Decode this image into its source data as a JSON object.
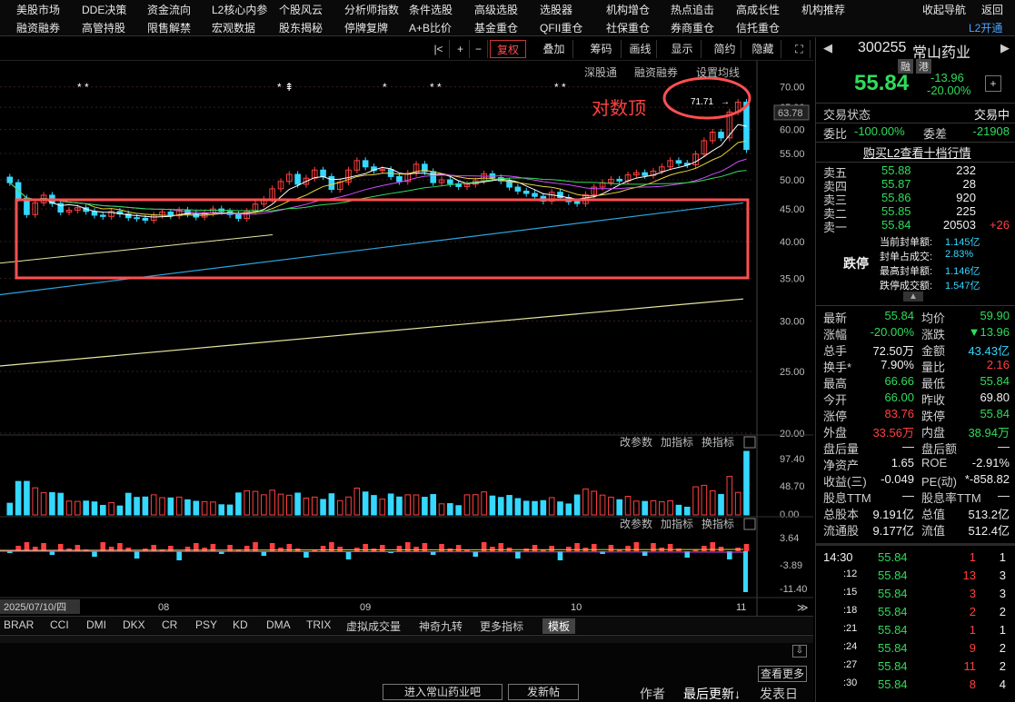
{
  "nav": {
    "row1": [
      "美股市场",
      "DDE决策",
      "资金流向",
      "L2核心内参",
      "个股风云",
      "分析师指数",
      "条件选股",
      "高级选股",
      "选股器",
      "机构增仓",
      "热点追击",
      "高成长性",
      "机构推荐",
      "收起导航",
      "返回"
    ],
    "row2": [
      "融资融券",
      "高管持股",
      "限售解禁",
      "宏观数据",
      "股东揭秘",
      "停牌复牌",
      "A+B比价",
      "基金重仓",
      "QFII重仓",
      "社保重仓",
      "券商重仓",
      "信托重仓",
      "L2开通"
    ]
  },
  "toolbar": {
    "items": [
      "|<",
      "+",
      "−",
      "复权",
      "叠加",
      "筹码",
      "画线",
      "显示",
      "简约",
      "隐藏",
      "⛶"
    ],
    "sub": [
      "深股通",
      "融资融券",
      "设置均线"
    ]
  },
  "chart": {
    "annotation": "对数顶",
    "peak_label": "71.71",
    "price_now": "63.78",
    "price_ticks": [
      "70.00",
      "65.00",
      "60.00",
      "55.00",
      "50.00",
      "45.00",
      "40.00",
      "35.00",
      "30.00",
      "25.00",
      "20.00"
    ],
    "vol_ticks": [
      "97.40",
      "48.70",
      "0.00"
    ],
    "macd_ticks": [
      "3.64",
      "-3.89",
      "-11.40"
    ],
    "panel_links": [
      "改参数",
      "加指标",
      "换指标"
    ],
    "dates": [
      "2025/07/10/四",
      "08",
      "09",
      "10",
      "11"
    ]
  },
  "chart_data": {
    "type": "candlestick",
    "price_range": [
      20,
      72
    ],
    "closes": [
      49.5,
      46.8,
      44.1,
      46.0,
      47.3,
      45.9,
      44.5,
      44.8,
      45.2,
      44.6,
      44.0,
      43.8,
      44.6,
      44.2,
      43.6,
      43.5,
      43.2,
      44.0,
      44.5,
      43.9,
      44.8,
      44.2,
      43.7,
      44.3,
      45.0,
      44.6,
      44.1,
      43.5,
      44.6,
      45.8,
      46.6,
      48.4,
      49.7,
      51.0,
      49.2,
      50.3,
      51.8,
      50.6,
      48.3,
      49.6,
      51.8,
      53.6,
      52.4,
      51.7,
      51.9,
      50.6,
      49.7,
      51.2,
      52.9,
      51.5,
      49.5,
      50.0,
      49.3,
      48.8,
      49.2,
      49.8,
      51.1,
      50.4,
      49.8,
      48.7,
      48.0,
      47.6,
      47.1,
      46.3,
      47.8,
      46.9,
      46.2,
      45.9,
      47.4,
      48.7,
      49.5,
      50.1,
      49.8,
      50.9,
      51.3,
      50.8,
      51.6,
      52.4,
      53.6,
      53.1,
      52.8,
      54.9,
      57.6,
      59.4,
      58.2,
      63.9,
      66.2,
      55.8
    ],
    "volume_max": 97.4,
    "macd_range": [
      -11.4,
      3.64
    ]
  },
  "quote": {
    "code": "300255",
    "name": "常山药业",
    "tags": [
      "融",
      "港"
    ],
    "price": "55.84",
    "change": "-13.96",
    "pct": "-20.00%",
    "status_label": "交易状态",
    "status": "交易中",
    "ratio_label": "委比",
    "ratio": "-100.00%",
    "diff_label": "委差",
    "diff": "-21908",
    "l2_link": "购买L2查看十档行情"
  },
  "asks": [
    {
      "label": "卖五",
      "price": "55.88",
      "vol": "232",
      "chg": ""
    },
    {
      "label": "卖四",
      "price": "55.87",
      "vol": "28",
      "chg": ""
    },
    {
      "label": "卖三",
      "price": "55.86",
      "vol": "920",
      "chg": ""
    },
    {
      "label": "卖二",
      "price": "55.85",
      "vol": "225",
      "chg": ""
    },
    {
      "label": "卖一",
      "price": "55.84",
      "vol": "20503",
      "chg": "+26"
    }
  ],
  "limit": {
    "label": "跌停",
    "lines": [
      {
        "k": "当前封单额:",
        "v": "1.145亿"
      },
      {
        "k": "封单占成交:",
        "v": "2.83%"
      },
      {
        "k": "最高封单额:",
        "v": "1.146亿"
      },
      {
        "k": "跌停成交额:",
        "v": "1.547亿"
      }
    ]
  },
  "stats": [
    {
      "l": "最新",
      "v": "55.84",
      "c": "green",
      "l2": "均价",
      "v2": "59.90",
      "c2": "green"
    },
    {
      "l": "涨幅",
      "v": "-20.00%",
      "c": "green",
      "l2": "涨跌",
      "v2": "▼13.96",
      "c2": "green"
    },
    {
      "l": "总手",
      "v": "72.50万",
      "c": "white",
      "l2": "金额",
      "v2": "43.43亿",
      "c2": "cyan"
    },
    {
      "l": "换手*",
      "v": "7.90%",
      "c": "white",
      "l2": "量比",
      "v2": "2.16",
      "c2": "red"
    },
    {
      "l": "最高",
      "v": "66.66",
      "c": "green",
      "l2": "最低",
      "v2": "55.84",
      "c2": "green"
    },
    {
      "l": "今开",
      "v": "66.00",
      "c": "green",
      "l2": "昨收",
      "v2": "69.80",
      "c2": "white"
    },
    {
      "l": "涨停",
      "v": "83.76",
      "c": "red",
      "l2": "跌停",
      "v2": "55.84",
      "c2": "green"
    },
    {
      "l": "外盘",
      "v": "33.56万",
      "c": "red",
      "l2": "内盘",
      "v2": "38.94万",
      "c2": "green"
    },
    {
      "l": "盘后量",
      "v": "—",
      "c": "white",
      "l2": "盘后额",
      "v2": "—",
      "c2": "white"
    },
    {
      "l": "净资产",
      "v": "1.65",
      "c": "white",
      "l2": "ROE",
      "v2": "-2.91%",
      "c2": "white"
    },
    {
      "l": "收益(三)",
      "v": "-0.049",
      "c": "white",
      "l2": "PE(动)",
      "v2": "*-858.82",
      "c2": "white"
    },
    {
      "l": "股息TTM",
      "v": "—",
      "c": "white",
      "l2": "股息率TTM",
      "v2": "—",
      "c2": "white"
    },
    {
      "l": "总股本",
      "v": "9.191亿",
      "c": "white",
      "l2": "总值",
      "v2": "513.2亿",
      "c2": "white"
    },
    {
      "l": "流通股",
      "v": "9.177亿",
      "c": "white",
      "l2": "流值",
      "v2": "512.4亿",
      "c2": "white"
    }
  ],
  "ticks": [
    {
      "t": "14:30",
      "p": "55.84",
      "v": "1",
      "n": "1"
    },
    {
      "t": ":12",
      "p": "55.84",
      "v": "13",
      "n": "3"
    },
    {
      "t": ":15",
      "p": "55.84",
      "v": "3",
      "n": "3"
    },
    {
      "t": ":18",
      "p": "55.84",
      "v": "2",
      "n": "2"
    },
    {
      "t": ":21",
      "p": "55.84",
      "v": "1",
      "n": "1"
    },
    {
      "t": ":24",
      "p": "55.84",
      "v": "9",
      "n": "2"
    },
    {
      "t": ":27",
      "p": "55.84",
      "v": "11",
      "n": "2"
    },
    {
      "t": ":30",
      "p": "55.84",
      "v": "8",
      "n": "4"
    }
  ],
  "indicator_tabs": [
    "BRAR",
    "CCI",
    "DMI",
    "DKX",
    "CR",
    "PSY",
    "KD",
    "DMA",
    "TRIX",
    "虚拟成交量",
    "神奇九转",
    "更多指标",
    "模板"
  ],
  "bottom": {
    "more": "查看更多",
    "enter_bar": "进入常山药业吧",
    "post": "发新帖",
    "author": "作者",
    "latest": "最后更新↓",
    "post_date": "发表日"
  },
  "colors": {
    "up": "#ff4040",
    "down": "#35d8ff",
    "box": "#ff5050"
  }
}
